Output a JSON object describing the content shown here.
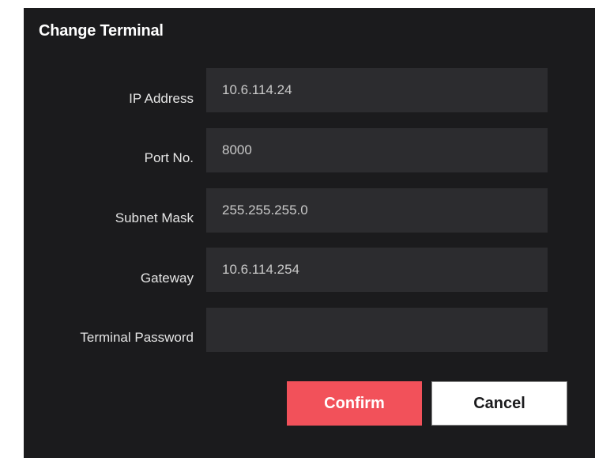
{
  "dialog": {
    "title": "Change Terminal"
  },
  "fields": {
    "ip_address": {
      "label": "IP Address",
      "value": "10.6.114.24"
    },
    "port": {
      "label": "Port No.",
      "value": "8000"
    },
    "subnet_mask": {
      "label": "Subnet Mask",
      "value": "255.255.255.0"
    },
    "gateway": {
      "label": "Gateway",
      "value": "10.6.114.254"
    },
    "terminal_password": {
      "label": "Terminal Password",
      "value": ""
    }
  },
  "buttons": {
    "confirm_label": "Confirm",
    "cancel_label": "Cancel"
  },
  "colors": {
    "dialog_background": "#1b1b1d",
    "field_background": "#2c2c2f",
    "confirm_accent": "#f2515a"
  }
}
